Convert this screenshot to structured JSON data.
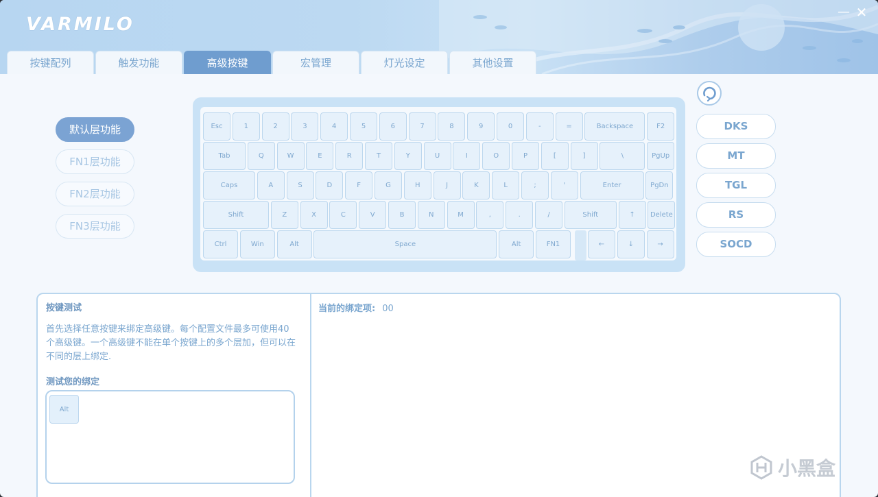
{
  "app": {
    "logo": "VARMILO",
    "minimize": "—",
    "close": "✕"
  },
  "tabs": [
    "按键配列",
    "触发功能",
    "高级按键",
    "宏管理",
    "灯光设定",
    "其他设置"
  ],
  "active_tab": 2,
  "layers": [
    "默认层功能",
    "FN1层功能",
    "FN2层功能",
    "FN3层功能"
  ],
  "active_layer": 0,
  "keyboard": {
    "rows": [
      [
        "Esc",
        "1",
        "2",
        "3",
        "4",
        "5",
        "6",
        "7",
        "8",
        "9",
        "0",
        "-",
        "=",
        "Backspace",
        "F2"
      ],
      [
        "Tab",
        "Q",
        "W",
        "E",
        "R",
        "T",
        "Y",
        "U",
        "I",
        "O",
        "P",
        "[",
        "]",
        "\\",
        "PgUp"
      ],
      [
        "Caps",
        "A",
        "S",
        "D",
        "F",
        "G",
        "H",
        "J",
        "K",
        "L",
        ";",
        "'",
        "Enter",
        "PgDn"
      ],
      [
        "Shift",
        "Z",
        "X",
        "C",
        "V",
        "B",
        "N",
        "M",
        ",",
        ".",
        "/",
        "Shift",
        "↑",
        "Delete"
      ],
      [
        "Ctrl",
        "Win",
        "Alt",
        "Space",
        "Alt",
        "FN1",
        "←",
        "↓",
        "→"
      ]
    ]
  },
  "advanced_keys": [
    "DKS",
    "MT",
    "TGL",
    "RS",
    "SOCD"
  ],
  "panel": {
    "title": "按键测试",
    "description": "首先选择任意按键来绑定高级键。每个配置文件最多可使用40个高级键。一个高级键不能在单个按键上的多个层加，但可以在不同的层上绑定.",
    "test_label": "测试您的绑定",
    "pressed_key": "Alt",
    "binding_label": "当前的绑定项:",
    "binding_value": "00"
  },
  "watermark": "小黑盒",
  "colors": {
    "accent": "#7ba3d3",
    "text": "#7aa6cf",
    "key_bg": "#e6f1fb"
  }
}
